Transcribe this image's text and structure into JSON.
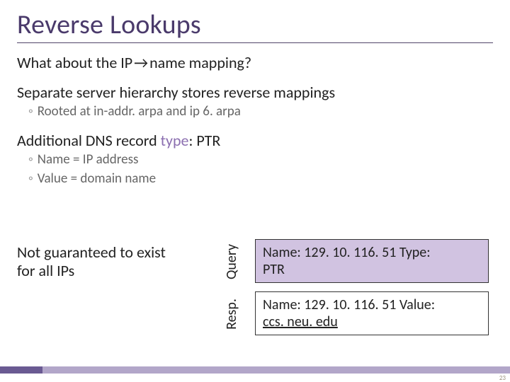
{
  "colors": {
    "title": "#4a3a6b",
    "accent": "#8b6fb0",
    "query_bg": "#d1c3e1",
    "footer_light": "#b2a6c9",
    "footer_dark": "#6a5a92"
  },
  "title": "Reverse Lookups",
  "line1_pre": "What about the IP",
  "line1_arrow": "→",
  "line1_post": "name mapping?",
  "line2": "Separate server hierarchy stores reverse mappings",
  "bullet_rooted": "Rooted at in-addr. arpa and ip 6. arpa",
  "line3_pre": "Additional DNS record ",
  "line3_type_word": "type",
  "line3_post": ": PTR",
  "bullet_name": "Name = IP address",
  "bullet_value": "Value = domain name",
  "left_note_l1": "Not guaranteed to exist",
  "left_note_l2": "for all IPs",
  "query_label": "Query",
  "query_text_l1": "Name: 129. 10. 116. 51 Type:",
  "query_text_l2": "PTR",
  "resp_label": "Resp.",
  "resp_text_l1": "Name: 129. 10. 116. 51 Value:",
  "resp_value": "ccs. neu. edu",
  "page_number": "23"
}
